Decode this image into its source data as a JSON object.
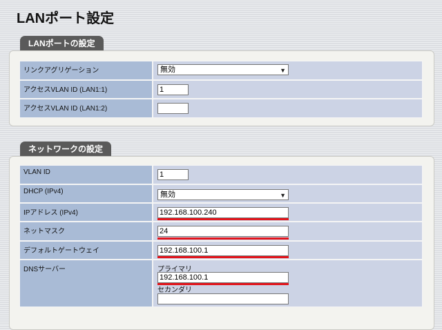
{
  "page": {
    "title": "LANポート設定"
  },
  "lan_port_section": {
    "tab_label": "LANポートの設定",
    "rows": [
      {
        "label": "リンクアグリゲーション",
        "value": "無効"
      },
      {
        "label": "アクセスVLAN ID (LAN1:1)",
        "value": "1"
      },
      {
        "label": "アクセスVLAN ID (LAN1:2)",
        "value": ""
      }
    ]
  },
  "network_section": {
    "tab_label": "ネットワークの設定",
    "rows": [
      {
        "label": "VLAN ID",
        "value": "1"
      },
      {
        "label": "DHCP (IPv4)",
        "value": "無効"
      },
      {
        "label": "IPアドレス (IPv4)",
        "value": "192.168.100.240"
      },
      {
        "label": "ネットマスク",
        "value": "24"
      },
      {
        "label": "デフォルトゲートウェイ",
        "value": "192.168.100.1"
      },
      {
        "label": "DNSサーバー",
        "primary_label": "プライマリ",
        "primary_value": "192.168.100.1",
        "secondary_label": "セカンダリ",
        "secondary_value": ""
      }
    ]
  },
  "icons": {
    "dropdown": "chevron-down-icon"
  },
  "colors": {
    "label_bg": "#a9bbd6",
    "value_bg": "#ccd3e5",
    "tab_bg": "#5a5a5a",
    "highlight": "#e3141b"
  }
}
